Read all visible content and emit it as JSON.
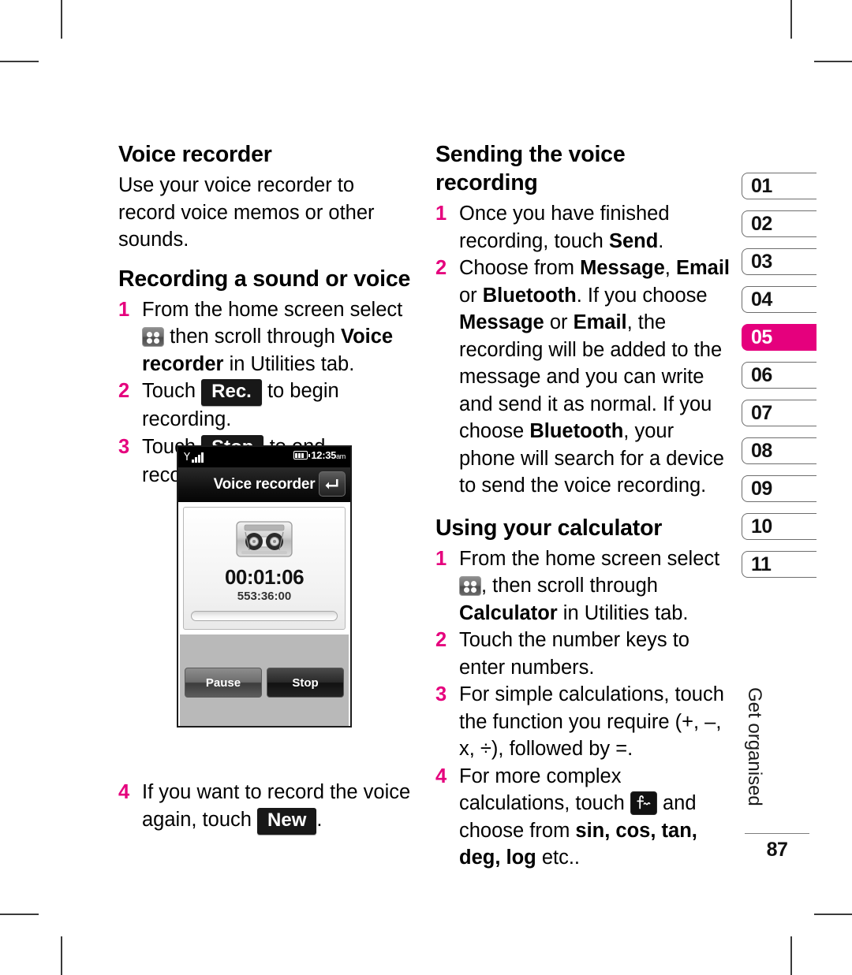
{
  "page": {
    "folio": "87",
    "running_head": "Get organised"
  },
  "left_column": {
    "heading_1": "Voice recorder",
    "intro": "Use your voice recorder to record voice memos or other sounds.",
    "heading_2": "Recording a sound or voice",
    "steps": [
      {
        "num": "1",
        "part_a": "From the home screen select",
        "icon": "app-grid-icon",
        "part_b": "then scroll through ",
        "bold_1": "Voice recorder",
        "part_c": " in Utilities tab."
      },
      {
        "num": "2",
        "part_a": "Touch",
        "key": "Rec.",
        "part_b": "to begin recording."
      },
      {
        "num": "3",
        "part_a": "Touch",
        "key": "Stop",
        "part_b": "to end recording."
      },
      {
        "num": "4",
        "part_a": "If you want to record the voice again, touch",
        "key": "New",
        "part_b": "."
      }
    ]
  },
  "phone_screenshot": {
    "status_bar": {
      "signal_icon": "signal-bars-icon",
      "battery_icon": "battery-icon",
      "time": "12:35",
      "meridiem": "am"
    },
    "title": "Voice recorder",
    "back_icon": "back-arrow-icon",
    "cassette_icon": "cassette-tape-icon",
    "elapsed_time": "00:01:06",
    "remaining_time": "553:36:00",
    "buttons": [
      {
        "label": "Pause",
        "name": "pause-button"
      },
      {
        "label": "Stop",
        "name": "stop-button"
      }
    ]
  },
  "right_column": {
    "heading_1": "Sending the voice recording",
    "send_steps": [
      {
        "num": "1",
        "part_a": "Once you have finished recording, touch ",
        "bold_1": "Send",
        "part_b": "."
      },
      {
        "num": "2",
        "part_a": "Choose from ",
        "bold_1": "Message",
        "part_b": ", ",
        "bold_2": "Email",
        "part_c": " or ",
        "bold_3": "Bluetooth",
        "part_d": ". If you choose ",
        "bold_4": "Message",
        "part_e": " or ",
        "bold_5": "Email",
        "part_f": ", the recording will be added to the message and you can write and send it as normal. If you choose ",
        "bold_6": "Bluetooth",
        "part_g": ", your phone will search for a device to send the voice recording."
      }
    ],
    "heading_2": "Using your calculator",
    "calc_steps": [
      {
        "num": "1",
        "part_a": "From the home screen select",
        "icon": "app-grid-icon",
        "part_b": ", then scroll through ",
        "bold_1": "Calculator",
        "part_c": " in Utilities tab."
      },
      {
        "num": "2",
        "part_a": "Touch the number keys to enter numbers."
      },
      {
        "num": "3",
        "part_a": "For simple calculations, touch the function you require (+, –, x, ÷), followed by =."
      },
      {
        "num": "4",
        "part_a": "For more complex calculations, touch",
        "icon": "math-function-icon",
        "part_b": " and choose from ",
        "bold_1": "sin, cos, tan, deg, log",
        "part_c": " etc.."
      }
    ]
  },
  "tab_rail": {
    "active_index": 4,
    "tabs": [
      "01",
      "02",
      "03",
      "04",
      "05",
      "06",
      "07",
      "08",
      "09",
      "10",
      "11"
    ]
  },
  "colors": {
    "accent": "#e5007d",
    "text": "#000000",
    "key_dark": "#181818"
  }
}
